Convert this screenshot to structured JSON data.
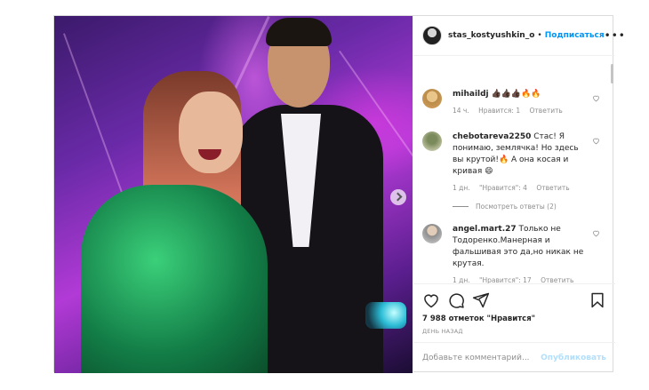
{
  "header": {
    "username": "stas_kostyushkin_o",
    "dot": "•",
    "follow": "Подписаться",
    "more": "•••"
  },
  "comments": [
    {
      "username": "mihaildj",
      "text": "👍🏿👍🏿👍🏿🔥🔥",
      "time": "14 ч.",
      "likes": "Нравится: 1",
      "reply": "Ответить"
    },
    {
      "username": "chebotareva2250",
      "text": "Стас! Я понимаю, землячка! Но здесь вы крутой!🔥 А она косая и кривая 😄",
      "time": "1 дн.",
      "likes": "\"Нравится\": 4",
      "reply": "Ответить"
    },
    {
      "username": "angel.mart.27",
      "text": "Только не Тодоренко.Манерная и фальшивая это да,но никак не крутая.",
      "time": "1 дн.",
      "likes": "\"Нравится\": 17",
      "reply": "Ответить"
    }
  ],
  "view_replies": "Посмотреть ответы (2)",
  "likes_count": "7 988 отметок \"Нравится\"",
  "posted": "ДЕНЬ НАЗАД",
  "add_comment": {
    "placeholder": "Добавьте комментарий...",
    "post": "Опубликовать"
  }
}
